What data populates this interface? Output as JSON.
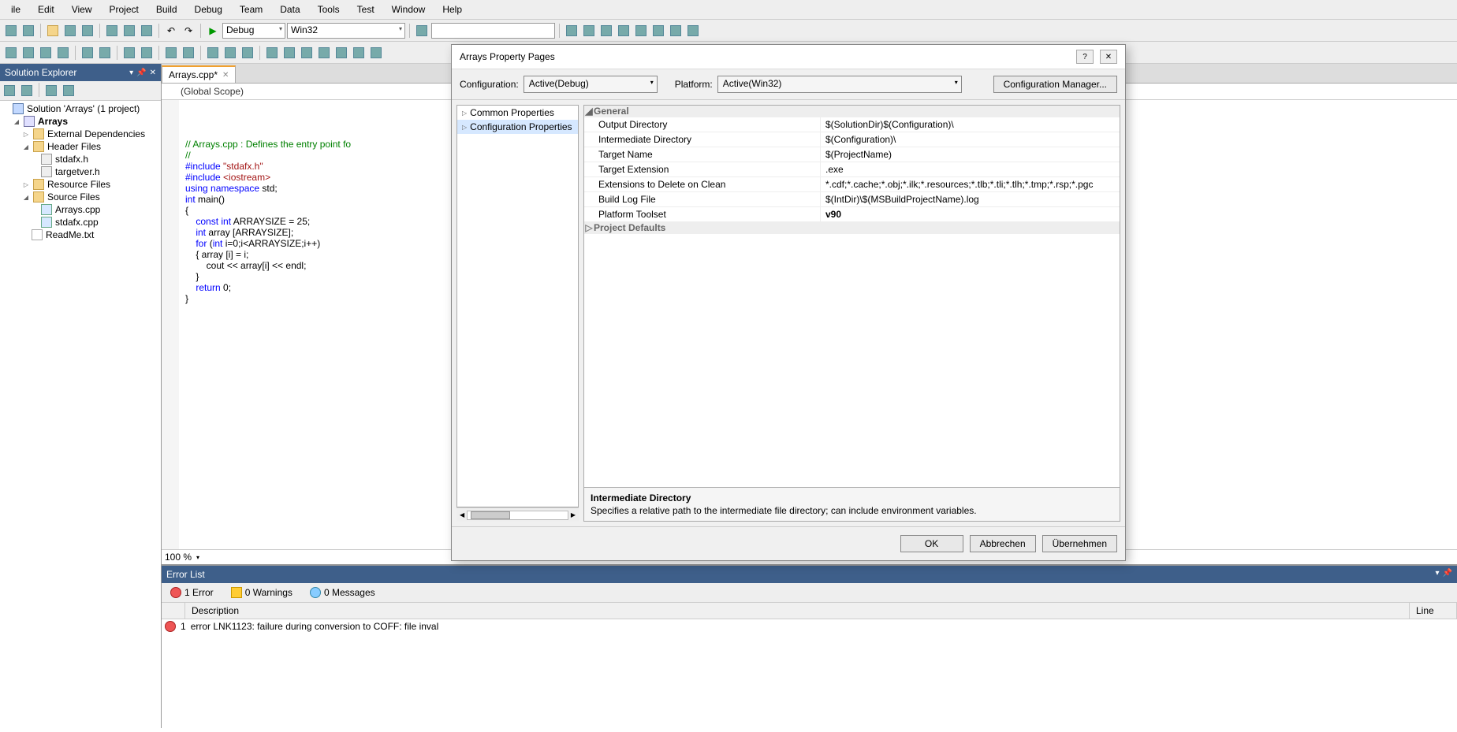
{
  "menu": [
    "ile",
    "Edit",
    "View",
    "Project",
    "Build",
    "Debug",
    "Team",
    "Data",
    "Tools",
    "Test",
    "Window",
    "Help"
  ],
  "toolbar1": {
    "config_combo": "Debug",
    "platform_combo": "Win32"
  },
  "solution_explorer": {
    "title": "Solution Explorer",
    "root": "Solution 'Arrays' (1 project)",
    "project": "Arrays",
    "folders": [
      {
        "name": "External Dependencies",
        "expanded": false
      },
      {
        "name": "Header Files",
        "expanded": true,
        "children": [
          "stdafx.h",
          "targetver.h"
        ]
      },
      {
        "name": "Resource Files",
        "expanded": false
      },
      {
        "name": "Source Files",
        "expanded": true,
        "children": [
          "Arrays.cpp",
          "stdafx.cpp"
        ]
      }
    ],
    "readme": "ReadMe.txt"
  },
  "editor": {
    "tab": "Arrays.cpp*",
    "scope": "(Global Scope)",
    "zoom": "100 %",
    "code_lines": [
      {
        "t": "cm",
        "s": "// Arrays.cpp : Defines the entry point fo"
      },
      {
        "t": "cm",
        "s": "//"
      },
      {
        "t": "",
        "s": ""
      },
      {
        "t": "pp",
        "s": "#include \"stdafx.h\""
      },
      {
        "t": "pp2",
        "s": "#include <iostream>"
      },
      {
        "t": "us",
        "s": "using namespace std;"
      },
      {
        "t": "",
        "s": ""
      },
      {
        "t": "",
        "s": ""
      },
      {
        "t": "fn",
        "s": "int main()"
      },
      {
        "t": "",
        "s": "{"
      },
      {
        "t": "ci",
        "s": "    const int ARRAYSIZE = 25;"
      },
      {
        "t": "ar",
        "s": "    int array [ARRAYSIZE];"
      },
      {
        "t": "",
        "s": ""
      },
      {
        "t": "fr",
        "s": "    for (int i=0;i<ARRAYSIZE;i++)"
      },
      {
        "t": "",
        "s": "    { array [i] = i;"
      },
      {
        "t": "",
        "s": "        cout << array[i] << endl;"
      },
      {
        "t": "",
        "s": "    }"
      },
      {
        "t": "",
        "s": ""
      },
      {
        "t": "rt",
        "s": "    return 0;"
      },
      {
        "t": "",
        "s": "}"
      }
    ]
  },
  "errorlist": {
    "title": "Error List",
    "filters": {
      "errors": "1 Error",
      "warnings": "0 Warnings",
      "messages": "0 Messages"
    },
    "columns": {
      "desc": "Description",
      "line": "Line"
    },
    "row": {
      "num": "1",
      "text": "error LNK1123: failure during conversion to COFF: file inval"
    }
  },
  "dialog": {
    "title": "Arrays Property Pages",
    "config_label": "Configuration:",
    "config_value": "Active(Debug)",
    "platform_label": "Platform:",
    "platform_value": "Active(Win32)",
    "cfgmgr": "Configuration Manager...",
    "tree": [
      "Common Properties",
      "Configuration Properties"
    ],
    "grid_cat1": "General",
    "grid": [
      {
        "k": "Output Directory",
        "v": "$(SolutionDir)$(Configuration)\\"
      },
      {
        "k": "Intermediate Directory",
        "v": "$(Configuration)\\"
      },
      {
        "k": "Target Name",
        "v": "$(ProjectName)"
      },
      {
        "k": "Target Extension",
        "v": ".exe"
      },
      {
        "k": "Extensions to Delete on Clean",
        "v": "*.cdf;*.cache;*.obj;*.ilk;*.resources;*.tlb;*.tli;*.tlh;*.tmp;*.rsp;*.pgc"
      },
      {
        "k": "Build Log File",
        "v": "$(IntDir)\\$(MSBuildProjectName).log"
      },
      {
        "k": "Platform Toolset",
        "v": "v90",
        "bold": true
      }
    ],
    "grid_cat2": "Project Defaults",
    "desc_title": "Intermediate Directory",
    "desc_text": "Specifies a relative path to the intermediate file directory; can include environment variables.",
    "buttons": {
      "ok": "OK",
      "cancel": "Abbrechen",
      "apply": "Übernehmen"
    }
  }
}
